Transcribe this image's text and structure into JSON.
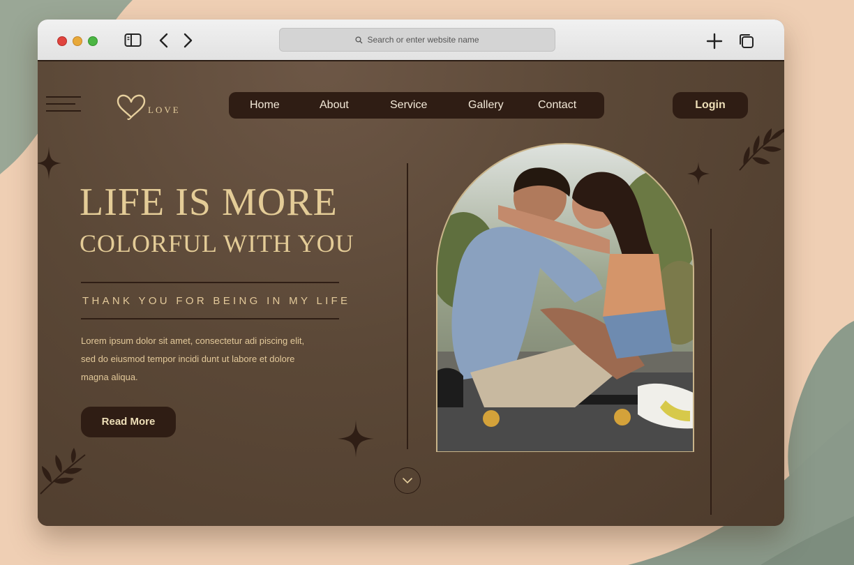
{
  "browser": {
    "address_placeholder": "Search or enter website name",
    "icons": [
      "sidebar-icon",
      "back-icon",
      "forward-icon",
      "new-tab-icon",
      "tabs-overview-icon",
      "search-icon"
    ]
  },
  "site": {
    "logo_text": "LOVE",
    "nav": [
      "Home",
      "About",
      "Service",
      "Gallery",
      "Contact"
    ],
    "login_label": "Login"
  },
  "hero": {
    "headline_line1": "LIFE IS MORE",
    "headline_line2": "COLORFUL WITH YOU",
    "tagline": "THANK YOU FOR BEING IN MY LIFE",
    "body_lines": [
      "Lorem ipsum dolor sit amet, consectetur adi piscing elit,",
      "sed do eiusmod tempor incidi dunt ut labore et dolore",
      "magna aliqua."
    ],
    "read_more_label": "Read More",
    "photo_subject": "couple-sitting-on-skateboard"
  },
  "colors": {
    "page_bg": "#5b4837",
    "dark_brown": "#2f1d14",
    "gold": "#e4cc97",
    "backdrop": "#efcfb4",
    "sage_leaf": "#8d9c8c"
  }
}
